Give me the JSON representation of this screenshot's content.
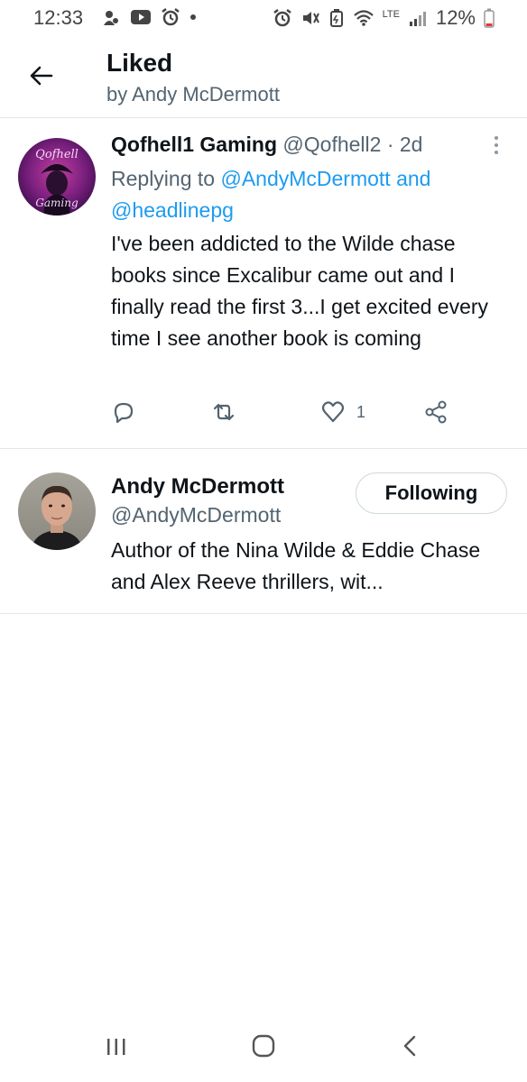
{
  "status_bar": {
    "time": "12:33",
    "battery": "12%",
    "network": "LTE"
  },
  "header": {
    "title": "Liked",
    "subtitle": "by Andy McDermott"
  },
  "tweet": {
    "author_name": "Qofhell1 Gaming",
    "author_handle": "@Qofhell2",
    "separator": " · ",
    "time": "2d",
    "replying_prefix": "Replying to ",
    "reply_mention_1": "@AndyMcDermott",
    "reply_and": " and ",
    "reply_mention_2": "@headlinepg",
    "text": "I've been addicted to the Wilde chase books since Excalibur came out and I finally read the first 3...I get excited every time I see another book is coming",
    "like_count": "1",
    "avatar_text_top": "Qofhell",
    "avatar_text_bottom": "Gaming"
  },
  "user": {
    "name": "Andy McDermott",
    "handle": "@AndyMcDermott",
    "follow_label": "Following",
    "bio": "Author of the Nina Wilde & Eddie Chase and Alex Reeve thrillers, wit..."
  },
  "colors": {
    "link": "#1d9bf0",
    "secondary_text": "#536471",
    "divider": "#e3e6e8"
  }
}
